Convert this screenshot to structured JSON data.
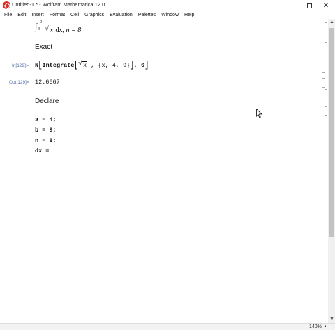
{
  "window": {
    "title": "Untitled-1 * - Wolfram Mathematica 12.0",
    "minimize_glyph": "",
    "close_glyph": "✕"
  },
  "menu": [
    "File",
    "Edit",
    "Insert",
    "Format",
    "Cell",
    "Graphics",
    "Evaluation",
    "Palettes",
    "Window",
    "Help"
  ],
  "notebook": {
    "integral": {
      "lower": "4",
      "upper": "9",
      "sym": "∫",
      "radicand": "x",
      "dx": "dx,",
      "n_part": "n = 8"
    },
    "exact_heading": "Exact",
    "input_label": "In[129]:=",
    "input": {
      "n": "N",
      "func": "Integrate",
      "radicand": "x",
      "range": "{x, 4, 9}",
      "digits": ", 6"
    },
    "output_label": "Out[129]=",
    "output_value": "12.6667",
    "declare_heading": "Declare",
    "code_lines": [
      "a = 4;",
      "b = 9;",
      "n = 8;",
      "dx ="
    ]
  },
  "status": {
    "zoom": "140%",
    "zoom_arrow": "▲"
  },
  "scroll": {
    "up": "▲",
    "down": "▼"
  }
}
